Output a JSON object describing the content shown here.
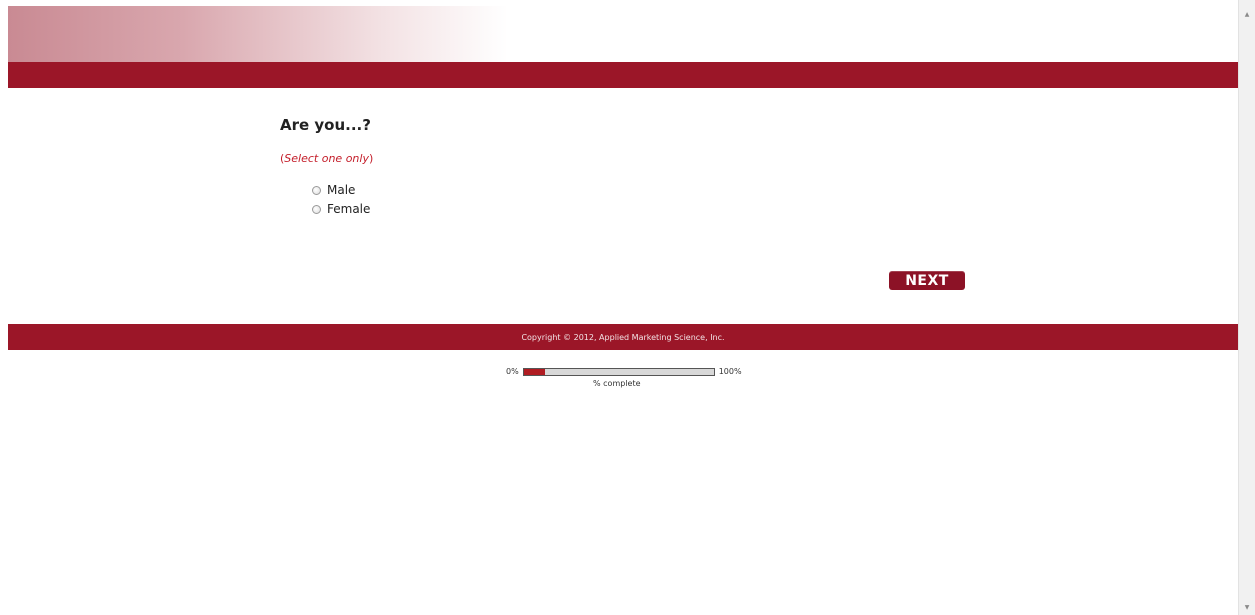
{
  "survey": {
    "question": "Are you...?",
    "instruction_open": "(",
    "instruction_italic": "Select one only",
    "instruction_close": ")",
    "options": [
      {
        "label": "Male"
      },
      {
        "label": "Female"
      }
    ],
    "next_label": "NEXT"
  },
  "footer": {
    "copyright": "Copyright © 2012, Applied Marketing Science, Inc."
  },
  "progress": {
    "min_label": "0%",
    "max_label": "100%",
    "caption": "% complete",
    "value_percent": 11
  },
  "colors": {
    "brand": "#9b1628",
    "instruction": "#c41e2a"
  },
  "icons": {
    "scroll_up": "▲",
    "scroll_down": "▼"
  }
}
